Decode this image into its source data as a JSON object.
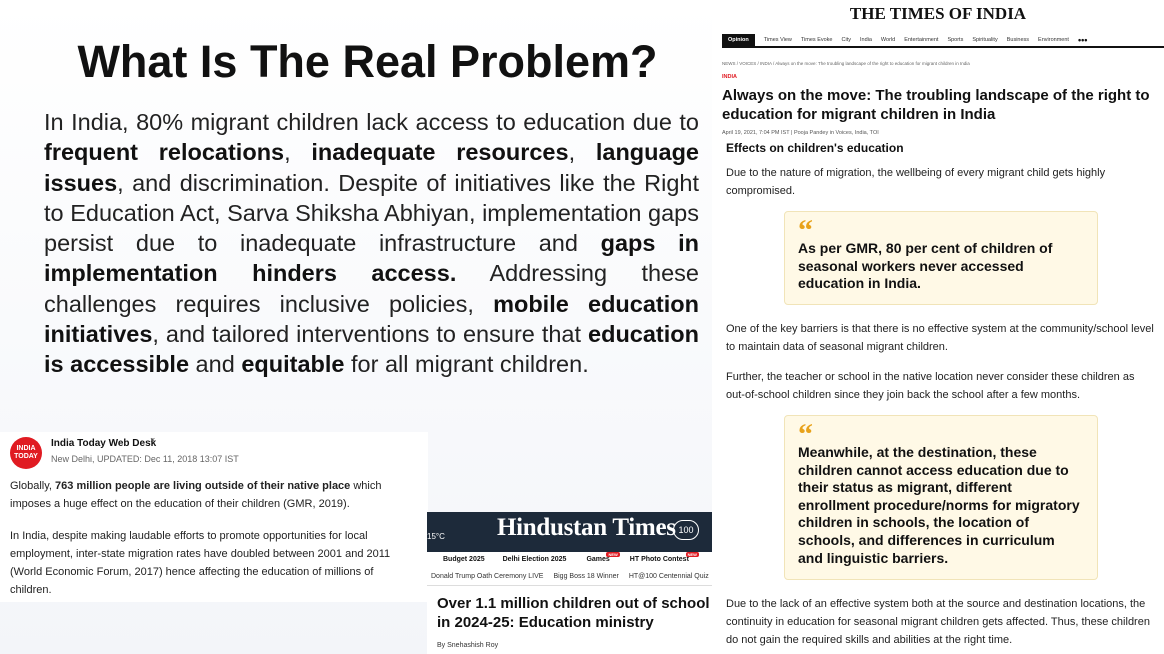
{
  "slide": {
    "title": "What Is The Real Problem?",
    "body": [
      {
        "t": "In India, 80% migrant children lack access to  education due to ",
        "b": false
      },
      {
        "t": "frequent relocations",
        "b": true
      },
      {
        "t": ", ",
        "b": false
      },
      {
        "t": "inadequate resources",
        "b": true
      },
      {
        "t": ", ",
        "b": false
      },
      {
        "t": "language issues",
        "b": true
      },
      {
        "t": ", and discrimination. Despite of initiatives like the Right to Education Act, Sarva Shiksha Abhiyan, implementation gaps persist due to inadequate infrastructure and ",
        "b": false
      },
      {
        "t": "gaps in implementation hinders access.",
        "b": true
      },
      {
        "t": " Addressing these challenges requires inclusive policies, ",
        "b": false
      },
      {
        "t": "mobile education initiatives",
        "b": true
      },
      {
        "t": ", and tailored interventions to ensure that ",
        "b": false
      },
      {
        "t": "education is accessible",
        "b": true
      },
      {
        "t": " and ",
        "b": false
      },
      {
        "t": "equitable",
        "b": true
      },
      {
        "t": " for all migrant children.",
        "b": false
      }
    ]
  },
  "india_today": {
    "logo_text": "INDIA TODAY",
    "author": "India Today Web Desk",
    "close": "×",
    "meta": "New Delhi, UPDATED: Dec 11, 2018 13:07 IST",
    "p1_pre": "Globally, ",
    "p1_bold": "763 million people are living outside of their native place",
    "p1_post": " which imposes a huge effect on the education of their children (GMR, 2019).",
    "p2": "In India, despite making laudable efforts to promote opportunities for local employment, inter-state migration rates have doubled between 2001 and 2011 (World Economic Forum, 2017) hence affecting the education of millions of children."
  },
  "hindustan_times": {
    "temp": "15°C",
    "logo": "Hindustan Times",
    "badge": "100",
    "nav": [
      "Budget 2025",
      "Delhi Election 2025",
      "Games",
      "HT Photo Contest"
    ],
    "hot_label": "NEW",
    "sub_nav": [
      "Donald Trump Oath Ceremony LIVE",
      "Bigg Boss 18 Winner",
      "HT@100 Centennial Quiz"
    ],
    "headline": "Over 1.1 million children out of school in 2024-25: Education ministry",
    "byline": "By Snehashish Roy"
  },
  "toi": {
    "masthead": "THE TIMES OF INDIA",
    "nav": [
      "Opinion",
      "Times View",
      "Times Evoke",
      "City",
      "India",
      "World",
      "Entertainment",
      "Sports",
      "Spirituality",
      "Business",
      "Environment"
    ],
    "more": "•••",
    "breadcrumb": "NEWS  /  VOICES  /  INDIA  /  Always on the move: The troubling landscape of the right to education for migrant children in India",
    "tag": "INDIA",
    "headline": "Always on the move: The troubling landscape of the right to education for migrant children in India",
    "byline": "April 19, 2021, 7:04 PM IST  |  Pooja Pandey in Voices, India, TOI",
    "section": "Effects on children's education",
    "p1": "Due to the nature of migration, the wellbeing of every migrant child gets highly compromised.",
    "quote_mark": "“",
    "quote1": "As per GMR, 80 per cent of children of seasonal workers never accessed education in India.",
    "p2": "One of the key barriers is that there is no effective system at the community/school level to maintain data of seasonal migrant children.",
    "p3": "Further, the teacher or school in the native location never consider these children as out-of-school children since they join back the school after a few months.",
    "quote2": "Meanwhile, at the destination, these children cannot access education due to their status as migrant, different enrollment procedure/norms for migratory children in schools, the location of schools, and differences in curriculum and linguistic barriers.",
    "p4": "Due to the lack of an effective system both at the source and destination locations, the continuity in education for seasonal migrant children gets affected. Thus, these children do not gain the required skills and abilities at the right time."
  }
}
